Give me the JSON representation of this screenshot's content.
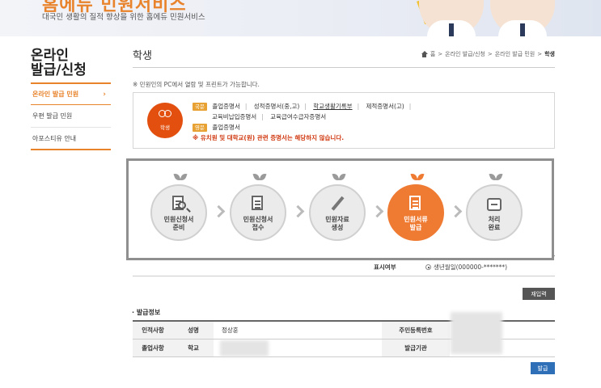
{
  "banner": {
    "brand": "홈에듀 민원서비스",
    "tagline": "대국민 생활의 질적 향상을 위한 홈에듀 민원서비스"
  },
  "sidebar": {
    "title_line1": "온라인",
    "title_line2": "발급/신청",
    "items": [
      {
        "label": "온라인 발급 민원",
        "active": true
      },
      {
        "label": "우편 발급 민원",
        "active": false
      },
      {
        "label": "아포스티유 안내",
        "active": false
      }
    ]
  },
  "header": {
    "title": "학생",
    "breadcrumb": [
      "홈",
      ">",
      "온라인 발급/신청",
      ">",
      "온라인 발급 민원",
      ">",
      "학생"
    ]
  },
  "notice": "※ 민원인의 PC에서 열람 및 프린트가 가능합니다.",
  "info": {
    "icon_label": "학생",
    "domestic_badge": "국문",
    "domestic_items": [
      "졸업증명서",
      "성적증명서(중,고)",
      "학교생활기록부",
      "제적증명서(고)"
    ],
    "domestic_items_2": [
      "교육비납입증명서",
      "교육급여수급자증명서"
    ],
    "english_badge": "영문",
    "english_items": [
      "졸업증명서"
    ],
    "warning": "※ 유치원 및 대학교(원) 관련 증명서는 해당하지 않습니다."
  },
  "steps": [
    {
      "line1": "민원신청서",
      "line2": "준비",
      "icon": "search-document-icon",
      "active": false
    },
    {
      "line1": "민원신청서",
      "line2": "접수",
      "icon": "document-icon",
      "active": false
    },
    {
      "line1": "민원자료",
      "line2": "생성",
      "icon": "pencil-icon",
      "active": false
    },
    {
      "line1": "민원서류",
      "line2": "발급",
      "icon": "download-document-icon",
      "active": true
    },
    {
      "line1": "처리",
      "line2": "완료",
      "icon": "folder-icon",
      "active": false
    }
  ],
  "form": {
    "display_label": "표시여부",
    "display_option": "생년월일(000000-*******)"
  },
  "buttons": {
    "reinput": "재입력",
    "issue": "발급"
  },
  "issue_info": {
    "section_title": "· 발급정보",
    "rows": [
      {
        "group": "인적사항",
        "field": "성명",
        "value": "정상훈",
        "field2": "주민등록번호"
      },
      {
        "group": "졸업사항",
        "field": "학교",
        "value": "",
        "field2": "발급기관"
      }
    ]
  }
}
